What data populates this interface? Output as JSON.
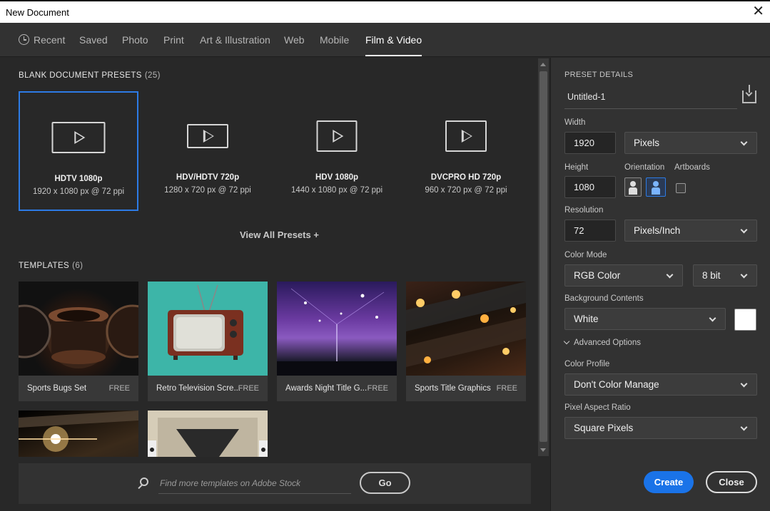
{
  "window": {
    "title": "New Document"
  },
  "tabs": [
    {
      "label": "Recent",
      "icon": "clock-icon"
    },
    {
      "label": "Saved"
    },
    {
      "label": "Photo"
    },
    {
      "label": "Print"
    },
    {
      "label": "Art & Illustration"
    },
    {
      "label": "Web"
    },
    {
      "label": "Mobile"
    },
    {
      "label": "Film & Video",
      "active": true
    }
  ],
  "presets_section": {
    "title": "BLANK DOCUMENT PRESETS",
    "count": "(25)"
  },
  "presets": [
    {
      "name": "HDTV 1080p",
      "dims": "1920 x 1080 px @ 72 ppi",
      "selected": true
    },
    {
      "name": "HDV/HDTV 720p",
      "dims": "1280 x 720 px @ 72 ppi"
    },
    {
      "name": "HDV 1080p",
      "dims": "1440 x 1080 px @ 72 ppi"
    },
    {
      "name": "DVCPRO HD 720p",
      "dims": "960 x 720 px @ 72 ppi"
    }
  ],
  "view_all": "View All Presets +",
  "templates_section": {
    "title": "TEMPLATES",
    "count": "(6)"
  },
  "templates": [
    {
      "name": "Sports Bugs Set",
      "price": "FREE"
    },
    {
      "name": "Retro Television Scre...",
      "price": "FREE"
    },
    {
      "name": "Awards Night Title G...",
      "price": "FREE"
    },
    {
      "name": "Sports Title Graphics",
      "price": "FREE"
    }
  ],
  "stock": {
    "placeholder": "Find more templates on Adobe Stock",
    "go_label": "Go"
  },
  "details": {
    "header": "PRESET DETAILS",
    "doc_name": "Untitled-1",
    "width_label": "Width",
    "width_value": "1920",
    "width_unit": "Pixels",
    "height_label": "Height",
    "height_value": "1080",
    "orientation_label": "Orientation",
    "artboards_label": "Artboards",
    "resolution_label": "Resolution",
    "resolution_value": "72",
    "resolution_unit": "Pixels/Inch",
    "color_mode_label": "Color Mode",
    "color_mode": "RGB Color",
    "bit_depth": "8 bit",
    "background_label": "Background Contents",
    "background": "White",
    "background_color": "#ffffff",
    "advanced_label": "Advanced Options",
    "color_profile_label": "Color Profile",
    "color_profile": "Don't Color Manage",
    "pixel_aspect_label": "Pixel Aspect Ratio",
    "pixel_aspect": "Square Pixels"
  },
  "actions": {
    "create": "Create",
    "close": "Close"
  },
  "colors": {
    "accent": "#1a73e8",
    "selection": "#2d7be5"
  }
}
